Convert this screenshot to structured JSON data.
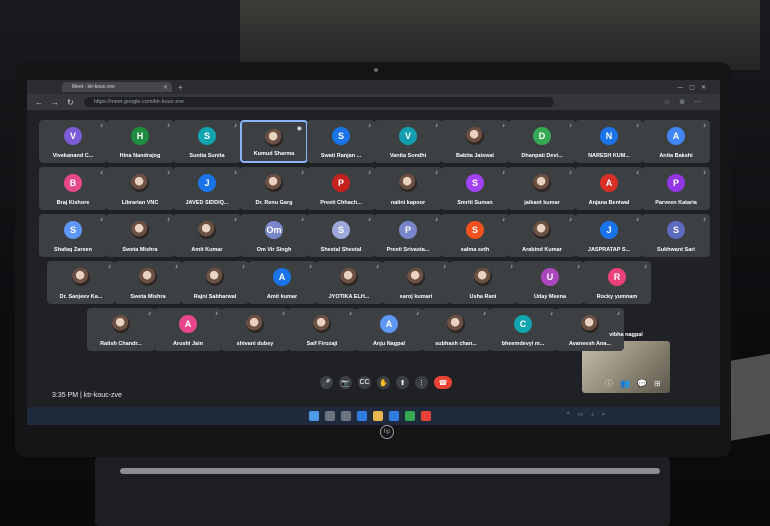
{
  "browser": {
    "tab_title": "Meet - ktr-kouc-zve",
    "url": "https://meet.google.com/ktr-kouc-zve"
  },
  "meeting": {
    "time": "3:35 PM",
    "code": "ktr-kouc-zve",
    "time_label": "3:35 PM  |  ktr-kouc-zve"
  },
  "participants": [
    {
      "name": "Vivekanand C...",
      "initial": "V",
      "color": "#7b5cd6"
    },
    {
      "name": "Hina Nandrajog",
      "initial": "H",
      "color": "#1e8e3e"
    },
    {
      "name": "Sunita Sunita",
      "initial": "S",
      "color": "#12a4af"
    },
    {
      "name": "Kumud Sharma",
      "initial": "",
      "color": "",
      "photo": true,
      "selected": true
    },
    {
      "name": "Swati Ranjan ...",
      "initial": "S",
      "color": "#1a73e8"
    },
    {
      "name": "Vanita Sondhi",
      "initial": "V",
      "color": "#129eaf"
    },
    {
      "name": "Babita Jaiswal",
      "initial": "",
      "color": "",
      "photo": true
    },
    {
      "name": "Dhanpati Devi...",
      "initial": "D",
      "color": "#34a853"
    },
    {
      "name": "NARESH KUM...",
      "initial": "N",
      "color": "#1a73e8"
    },
    {
      "name": "Anita Bakshi",
      "initial": "A",
      "color": "#4285f4"
    },
    {
      "name": "Braj Kishore",
      "initial": "B",
      "color": "#e8478b"
    },
    {
      "name": "Librarian VNC",
      "initial": "",
      "color": "",
      "photo": true
    },
    {
      "name": "JAVED SIDDIQ...",
      "initial": "J",
      "color": "#1a73e8"
    },
    {
      "name": "Dr. Renu Garg",
      "initial": "",
      "color": "",
      "photo": true
    },
    {
      "name": "Preeti Chhach...",
      "initial": "P",
      "color": "#c5221f"
    },
    {
      "name": "nalini kapoor",
      "initial": "",
      "color": "",
      "photo": true
    },
    {
      "name": "Smriti Suman",
      "initial": "S",
      "color": "#a142f4"
    },
    {
      "name": "jaikant kumar",
      "initial": "",
      "color": "",
      "photo": true
    },
    {
      "name": "Anjana Beniwal",
      "initial": "A",
      "color": "#d93025"
    },
    {
      "name": "Parveen Kataria",
      "initial": "P",
      "color": "#9334e6"
    },
    {
      "name": "Shafaq Zareen",
      "initial": "S",
      "color": "#5e97f6"
    },
    {
      "name": "Sweta Mishra",
      "initial": "",
      "color": "",
      "photo": true
    },
    {
      "name": "Amit Kumar",
      "initial": "",
      "color": "",
      "photo": true
    },
    {
      "name": "Om Vir Singh",
      "initial": "Om",
      "color": "#7986cb"
    },
    {
      "name": "Sheetal Sheetal",
      "initial": "S",
      "color": "#9fa8da"
    },
    {
      "name": "Preeti Srivasta...",
      "initial": "P",
      "color": "#7986cb"
    },
    {
      "name": "salma seth",
      "initial": "S",
      "color": "#f4511e"
    },
    {
      "name": "Arabind Kumar",
      "initial": "",
      "color": "",
      "photo": true
    },
    {
      "name": "JASPRATAP S...",
      "initial": "J",
      "color": "#1a73e8"
    },
    {
      "name": "Sukhwant Sari",
      "initial": "S",
      "color": "#5c6bc0"
    },
    {
      "name": "Dr. Sanjeev Ka...",
      "initial": "",
      "color": "",
      "photo": true
    },
    {
      "name": "Sweta Mishra",
      "initial": "",
      "color": "",
      "photo": true
    },
    {
      "name": "Rajni Sabharwal",
      "initial": "",
      "color": "",
      "photo": true
    },
    {
      "name": "Amit kumar",
      "initial": "A",
      "color": "#1a73e8"
    },
    {
      "name": "JYOTIKA ELH...",
      "initial": "",
      "color": "",
      "photo": true
    },
    {
      "name": "saroj kumari",
      "initial": "",
      "color": "",
      "photo": true
    },
    {
      "name": "Usha Rani",
      "initial": "",
      "color": "",
      "photo": true
    },
    {
      "name": "Uday Meena",
      "initial": "U",
      "color": "#ab47bc"
    },
    {
      "name": "Rocky yumnam",
      "initial": "R",
      "color": "#ec407a"
    },
    {
      "name": "Ratish Chandr...",
      "initial": "",
      "color": "",
      "photo": true
    },
    {
      "name": "Arushi Jain",
      "initial": "A",
      "color": "#e8478b"
    },
    {
      "name": "shivani dubey",
      "initial": "",
      "color": "",
      "photo": true
    },
    {
      "name": "Saif Firozaji",
      "initial": "",
      "color": "",
      "photo": true
    },
    {
      "name": "Anju Nagpal",
      "initial": "A",
      "color": "#5e97f6"
    },
    {
      "name": "subhash chan...",
      "initial": "",
      "color": "",
      "photo": true
    },
    {
      "name": "bheemdevyi m...",
      "initial": "C",
      "color": "#12a4af"
    },
    {
      "name": "Avaneesh Ana...",
      "initial": "",
      "color": "",
      "photo": true
    }
  ],
  "self_view": {
    "name": "vibha nagpal"
  },
  "controls": {
    "mic": "🎤",
    "camera": "📷",
    "captions": "CC",
    "hand": "✋",
    "present": "⬆",
    "more": "⋮",
    "end": "☎",
    "info": "ⓘ",
    "people": "👥",
    "chat": "💬",
    "activities": "⊞"
  },
  "laptop": {
    "logo": "hp"
  }
}
